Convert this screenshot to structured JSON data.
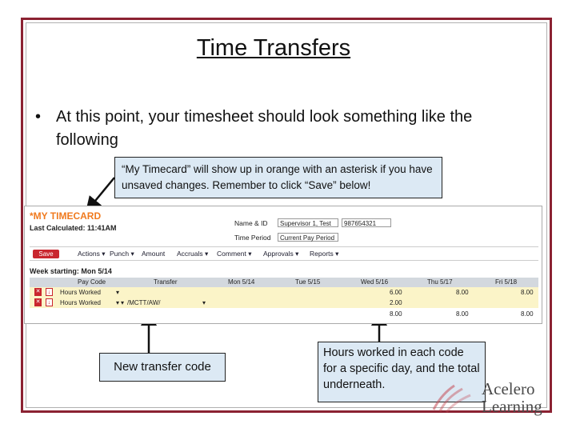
{
  "slide": {
    "title": "Time Transfers",
    "bullet": "•",
    "bullet_text": "At this point, your timesheet should look something like the following"
  },
  "callouts": {
    "top": "“My Timecard” will show up in orange with an asterisk if you have unsaved changes. Remember to click “Save” below!",
    "left": "New transfer code",
    "right": "Hours worked in each code for a specific day, and the total underneath."
  },
  "timecard": {
    "title": "*MY TIMECARD",
    "last_calculated": "Last Calculated: 11:41AM",
    "name_label": "Name & ID",
    "name_value": "Supervisor 1, Test",
    "id_value": "987654321",
    "period_label": "Time Period",
    "period_value": "Current Pay Period",
    "save_label": "Save",
    "menus": [
      "Actions ▾",
      "Punch ▾",
      "Amount",
      "Accruals ▾",
      "Comment ▾",
      "Approvals ▾",
      "Reports ▾"
    ],
    "week_label": "Week starting: Mon 5/14",
    "columns": [
      "Pay Code",
      "Transfer",
      "Mon 5/14",
      "Tue 5/15",
      "Wed 5/16",
      "Thu 5/17",
      "Fri 5/18"
    ],
    "rows": [
      {
        "pay_code": "Hours Worked",
        "transfer": "",
        "wed": "6.00",
        "thu": "8.00",
        "fri": "8.00"
      },
      {
        "pay_code": "Hours Worked",
        "transfer": "/MCTT/AW/",
        "wed": "2.00",
        "thu": "",
        "fri": ""
      }
    ],
    "totals": {
      "wed": "8.00",
      "thu": "8.00",
      "fri": "8.00"
    }
  },
  "logo": {
    "line1": "Acelero",
    "line2": "Learning"
  },
  "colors": {
    "frame": "#8b2232",
    "timecard_title": "#f07a1e",
    "save_button": "#c9262e",
    "callout_bg": "#dce9f4",
    "row_highlight": "#fbf4c8"
  }
}
